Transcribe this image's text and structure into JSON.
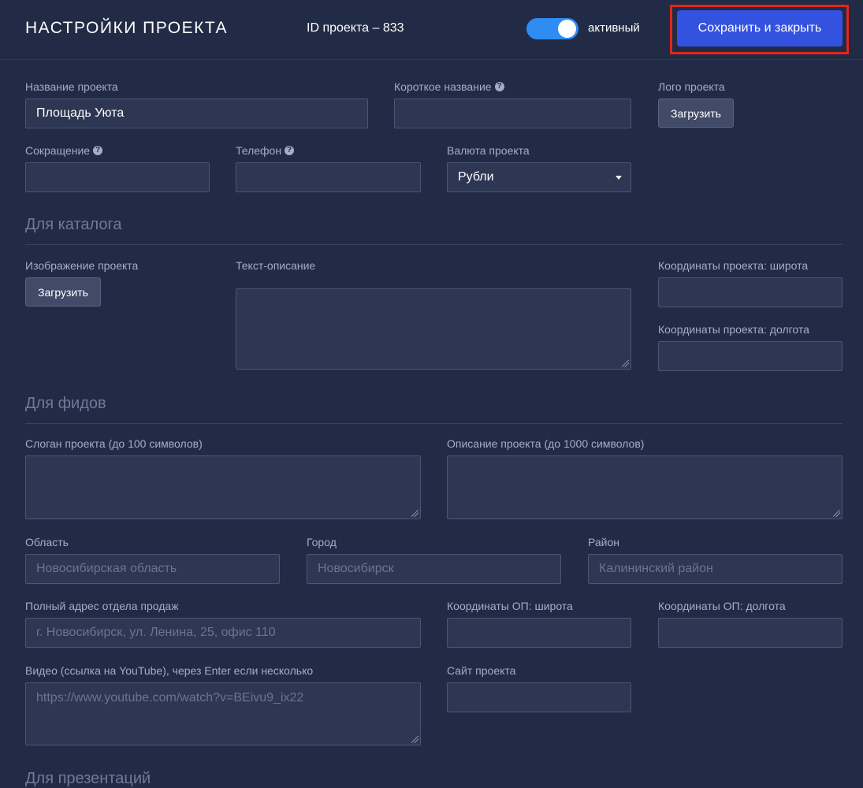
{
  "header": {
    "title": "НАСТРОЙКИ ПРОЕКТА",
    "project_id": "ID проекта – 833",
    "toggle_label": "активный",
    "save_label": "Сохранить и закрыть"
  },
  "main": {
    "project_name": {
      "label": "Название проекта",
      "value": "Площадь Уюта"
    },
    "short_name": {
      "label": "Короткое название",
      "value": ""
    },
    "logo": {
      "label": "Лого проекта",
      "button": "Загрузить"
    },
    "abbreviation": {
      "label": "Сокращение",
      "value": ""
    },
    "phone": {
      "label": "Телефон",
      "value": ""
    },
    "currency": {
      "label": "Валюта проекта",
      "value": "Рубли"
    }
  },
  "catalog": {
    "title": "Для каталога",
    "image": {
      "label": "Изображение проекта",
      "button": "Загрузить"
    },
    "description": {
      "label": "Текст-описание",
      "value": ""
    },
    "latitude": {
      "label": "Координаты проекта: широта",
      "value": ""
    },
    "longitude": {
      "label": "Координаты проекта: долгота",
      "value": ""
    }
  },
  "feeds": {
    "title": "Для фидов",
    "slogan": {
      "label": "Слоган проекта (до 100 символов)",
      "value": ""
    },
    "description": {
      "label": "Описание проекта (до 1000 символов)",
      "value": ""
    },
    "region": {
      "label": "Область",
      "placeholder": "Новосибирская область"
    },
    "city": {
      "label": "Город",
      "placeholder": "Новосибирск"
    },
    "district": {
      "label": "Район",
      "placeholder": "Калининский район"
    },
    "address": {
      "label": "Полный адрес отдела продаж",
      "placeholder": "г. Новосибирск, ул. Ленина, 25, офис 110"
    },
    "op_latitude": {
      "label": "Координаты ОП: широта",
      "value": ""
    },
    "op_longitude": {
      "label": "Координаты ОП: долгота",
      "value": ""
    },
    "video": {
      "label": "Видео (ссылка на YouTube), через Enter если несколько",
      "placeholder": "https://www.youtube.com/watch?v=BEivu9_ix22"
    },
    "site": {
      "label": "Сайт проекта",
      "value": ""
    }
  },
  "presentations": {
    "title": "Для презентаций"
  },
  "colors": {
    "background": "#222b45",
    "accent": "#3452e0",
    "toggle": "#2f8cf3",
    "highlight": "#e0261c"
  },
  "icons": {
    "help": "question-circle-icon",
    "dropdown": "caret-down-icon",
    "resize": "resize-grip-icon"
  }
}
